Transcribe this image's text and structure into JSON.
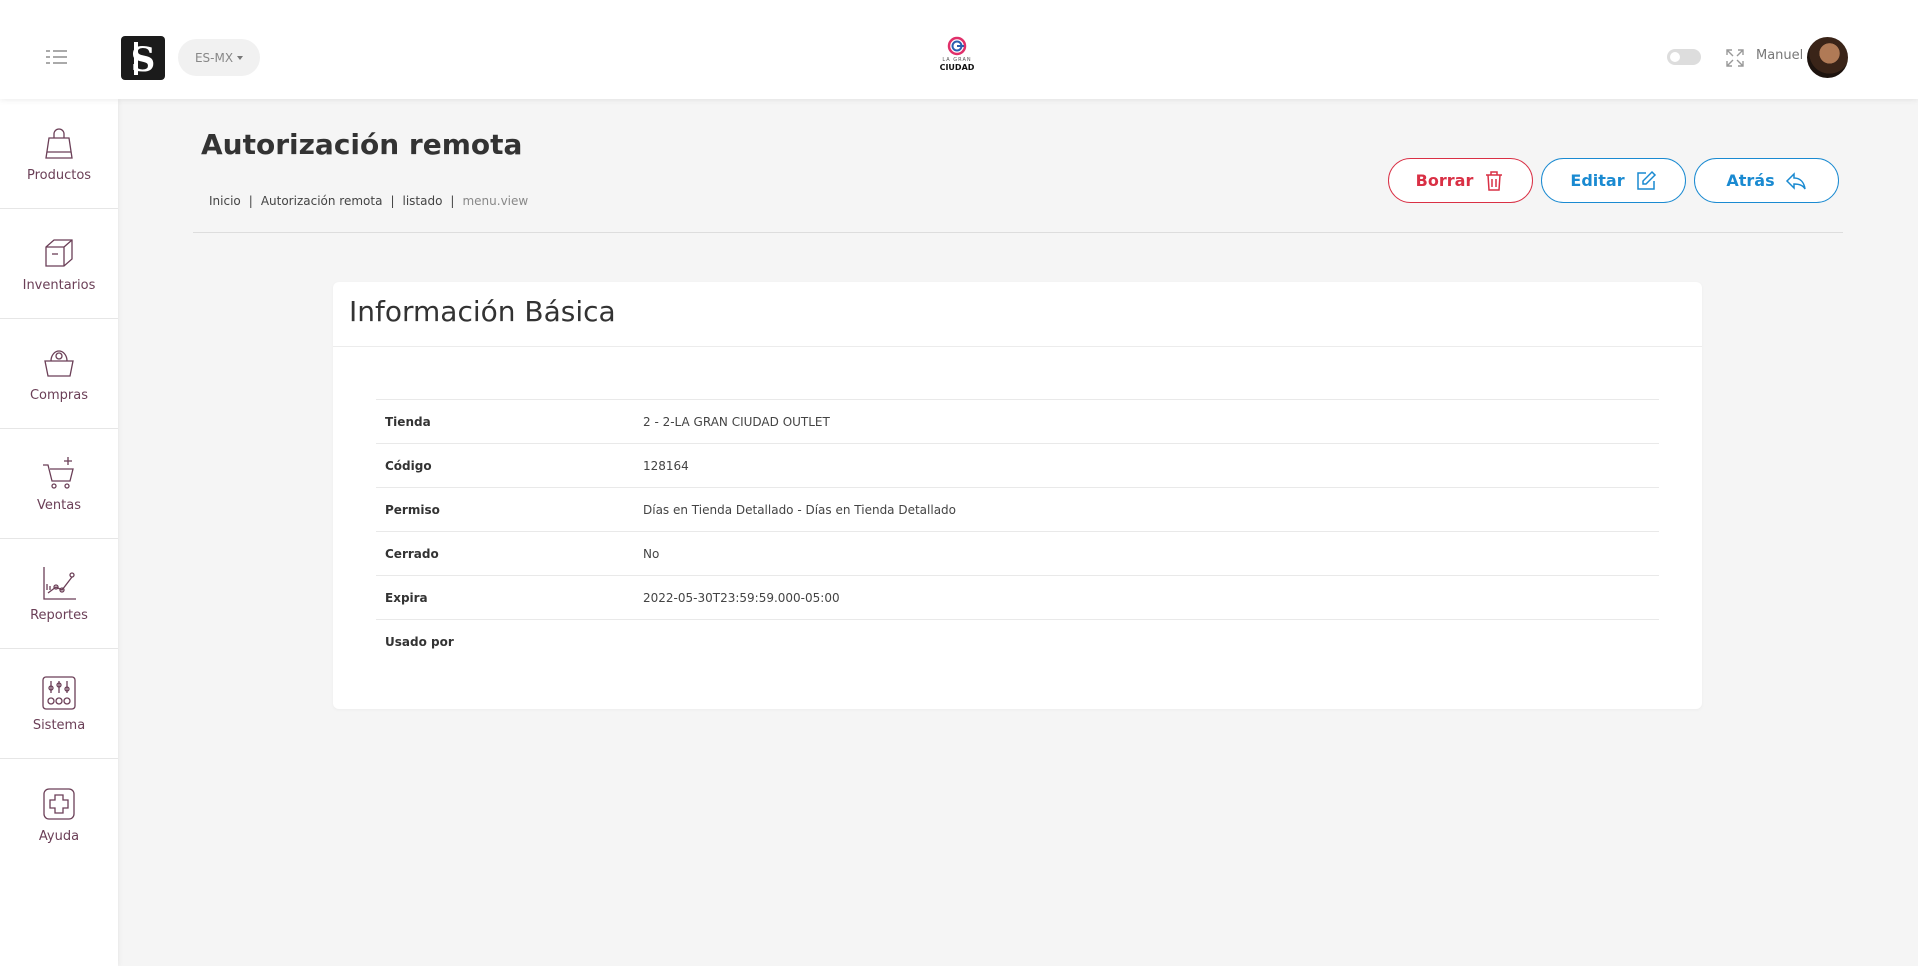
{
  "header": {
    "language": "ES-MX",
    "center_logo_small": "LA GRAN",
    "center_logo_big": "CIUDAD",
    "user_name": "Manuel"
  },
  "sidebar": {
    "items": [
      {
        "label": "Productos",
        "icon": "shopping-bag-icon"
      },
      {
        "label": "Inventarios",
        "icon": "box-icon"
      },
      {
        "label": "Compras",
        "icon": "basket-icon"
      },
      {
        "label": "Ventas",
        "icon": "cart-icon"
      },
      {
        "label": "Reportes",
        "icon": "chart-icon"
      },
      {
        "label": "Sistema",
        "icon": "control-panel-icon"
      },
      {
        "label": "Ayuda",
        "icon": "help-plus-icon"
      }
    ]
  },
  "page": {
    "title": "Autorización remota",
    "breadcrumb": [
      "Inicio",
      "Autorización remota",
      "listado",
      "menu.view"
    ]
  },
  "actions": {
    "delete_label": "Borrar",
    "edit_label": "Editar",
    "back_label": "Atrás"
  },
  "colors": {
    "accent": "#1a8ad1",
    "danger": "#d93045",
    "sidebar_icon": "#6b3f57"
  },
  "card": {
    "title": "Información Básica",
    "rows": [
      {
        "key": "Tienda",
        "value": "2 - 2-LA GRAN CIUDAD OUTLET"
      },
      {
        "key": "Código",
        "value": "128164"
      },
      {
        "key": "Permiso",
        "value": "Días en Tienda Detallado - Días en Tienda Detallado"
      },
      {
        "key": "Cerrado",
        "value": "No"
      },
      {
        "key": "Expira",
        "value": "2022-05-30T23:59:59.000-05:00"
      },
      {
        "key": "Usado por",
        "value": ""
      }
    ]
  }
}
